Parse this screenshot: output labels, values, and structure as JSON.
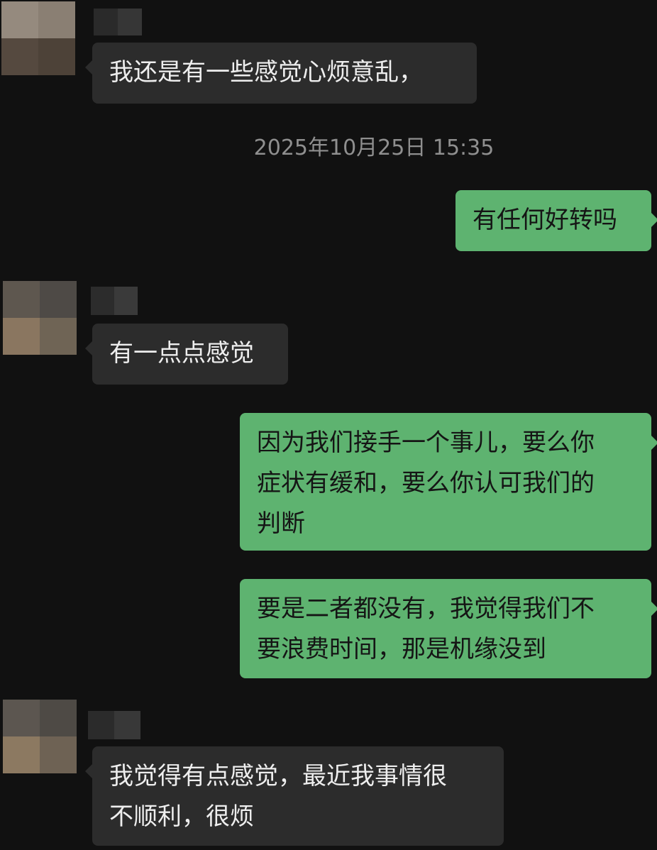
{
  "messages": [
    {
      "side": "in",
      "text": "我还是有一些感觉心烦意乱，"
    },
    {
      "type": "timestamp",
      "text": "2025年10月25日 15:35"
    },
    {
      "side": "out",
      "text": "有任何好转吗"
    },
    {
      "side": "in",
      "text": "有一点点感觉"
    },
    {
      "side": "out",
      "text": "因为我们接手一个事儿，要么你\n症状有缓和，要么你认可我们的\n判断"
    },
    {
      "side": "out",
      "text": "要是二者都没有，我觉得我们不\n要浪费时间，那是机缘没到"
    },
    {
      "side": "in",
      "text": "我觉得有点感觉，最近我事情很\n不顺利，很烦"
    }
  ],
  "colors": {
    "background": "#111111",
    "incoming_bubble": "#2c2c2c",
    "outgoing_bubble": "#5eb370",
    "timestamp_text": "#8f8f8f"
  },
  "avatar_icon": "blurred-avatar-icon"
}
